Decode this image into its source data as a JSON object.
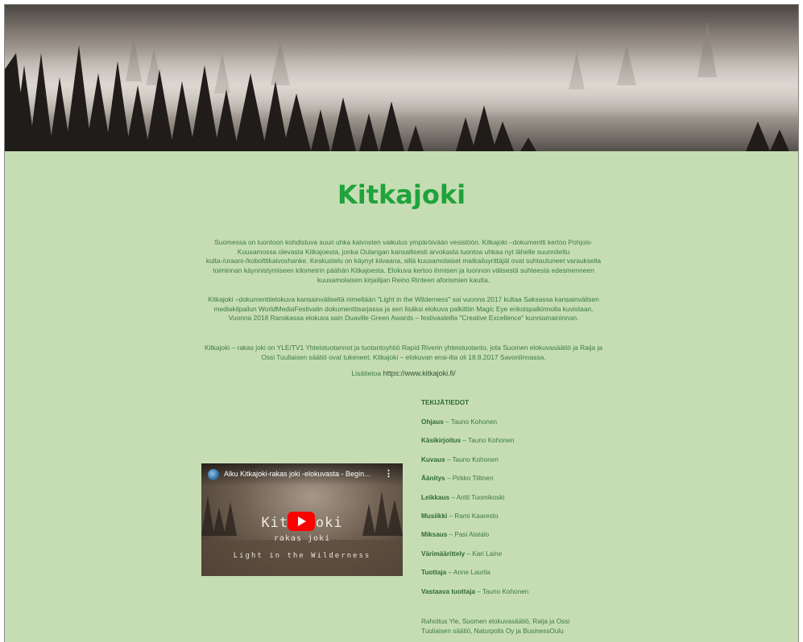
{
  "page": {
    "title": "Kitkajoki",
    "paragraphs": [
      "Suomessa on luontoon kohdistuva suuri uhka kaivosten vaikutus ympäröivään vesistöön. Kitkajoki –dokumentti kertoo Pohjois-Kuusamossa olevasta Kitkajoesta, jonka Oulangan kansallisesti arvokasta luontoa uhkaa nyt lähelle suunniteltu kulta-/uraani-/kobolttikaivoshanke. Keskustelu on käynyt kiivaana, sillä kuusamolaiset matkailuyrittäjät ovat suhtautuneet varauksella toiminnan käynnistymiseen kilometrin päähän Kitkajoesta. Elokuva kertoo ihmisen ja luonnon välisestä suhteesta edesmenneen kuusamolaisen kirjailijan Reino Rinteen aforismien kautta.",
      "Kitkajoki –dokumenttielokuva kansainväliseltä nimeltään \"Light in the Wilderness\" sai vuonna 2017 kultaa Saksassa kansainvälisen mediakilpailun WorldMediaFestivalin dokumenttisarjassa ja sen lisäksi elokuva palkittiin Magic Eye erikoispalkinnolla kuvistaan. Vuonna 2018 Ranskassa elokuva sain Duaville Green Awards – festivaaleilla \"Creative Excellence\" kunniamaininnan.",
      "Kitkajoki – rakas joki on YLE/TV1 Yhteistuotannot ja tuotantoyhtiö Rapid Riverin yhteistuotanto, jota Suomen elokuvasäätiö ja Raija ja Ossi Tuuliaisen säätiö ovat tukeneet. Kitkajoki – elokuvan ensi-ilta oli 18.8.2017 Savonlinnassa."
    ],
    "more_info_label": "Lisätietoa",
    "more_info_url": "https://www.kitkajoki.fi/"
  },
  "video": {
    "title": "Alku Kitkajoki-rakas joki -elokuvasta - Begin...",
    "menu_glyph": "⋮",
    "overlay_main": "Kitkajoki",
    "overlay_sub1": "rakas joki",
    "overlay_sub2": "Light in the Wilderness",
    "play_color": "#ff0000"
  },
  "credits": {
    "heading": "TEKIJÄTIEDOT",
    "separator": " – ",
    "items": [
      {
        "role": "Ohjaus",
        "name": "Tauno Kohonen"
      },
      {
        "role": "Käsikirjoitus",
        "name": "Tauno Kohonen"
      },
      {
        "role": "Kuvaus",
        "name": "Tauno Kohonen"
      },
      {
        "role": "Äänitys",
        "name": "Pirkko Tiitinen"
      },
      {
        "role": "Leikkaus",
        "name": "Antti Tuomikoski"
      },
      {
        "role": "Musiikki",
        "name": "Rami Kaaresto"
      },
      {
        "role": "Miksaus",
        "name": "Pasi Alatalo"
      },
      {
        "role": "Värimäärittely",
        "name": "Kari Laine"
      },
      {
        "role": "Tuottaja",
        "name": "Anne Laurila"
      },
      {
        "role": "Vastaava tuottaja",
        "name": "Tauno Kohonen"
      }
    ],
    "funding": "Rahoitus Yle, Suomen elokuvasäätiö, Raija ja Ossi Tuuliaisen säätiö, Naturpolis Oy ja BusinessOulu"
  },
  "colors": {
    "background": "#c6ddb4",
    "title": "#1fa33b",
    "text": "#3b7a3f"
  }
}
